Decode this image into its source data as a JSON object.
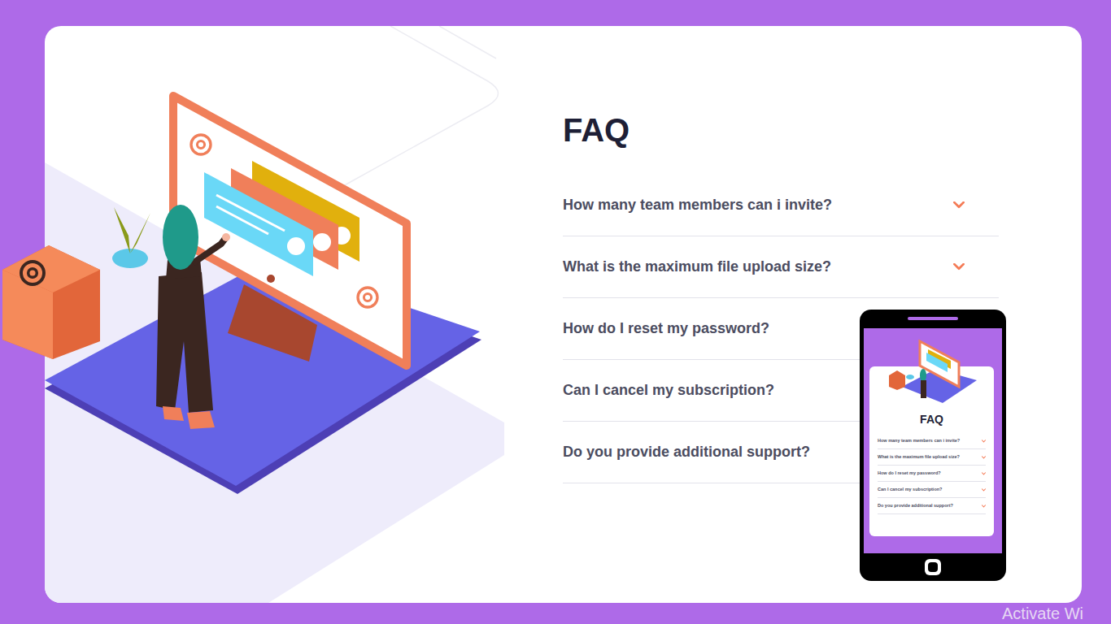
{
  "faq": {
    "title": "FAQ",
    "items": [
      {
        "question": "How many team members can i invite?",
        "expanded": false
      },
      {
        "question": "What is the maximum file upload size?",
        "expanded": false
      },
      {
        "question": "How do I reset my password?",
        "expanded": false
      },
      {
        "question": "Can I cancel my subscription?",
        "expanded": false
      },
      {
        "question": "Do you provide additional support?",
        "expanded": false
      }
    ]
  },
  "phone_preview": {
    "title": "FAQ",
    "items": [
      {
        "question": "How many team members can i invite?",
        "expanded": false
      },
      {
        "question": "What is the maximum file upload size?",
        "expanded": false
      },
      {
        "question": "How do I reset my password?",
        "expanded": false
      },
      {
        "question": "Can I cancel my subscription?",
        "expanded": false
      },
      {
        "question": "Do you provide additional support?",
        "expanded": false
      }
    ]
  },
  "watermark": "Activate Wi"
}
